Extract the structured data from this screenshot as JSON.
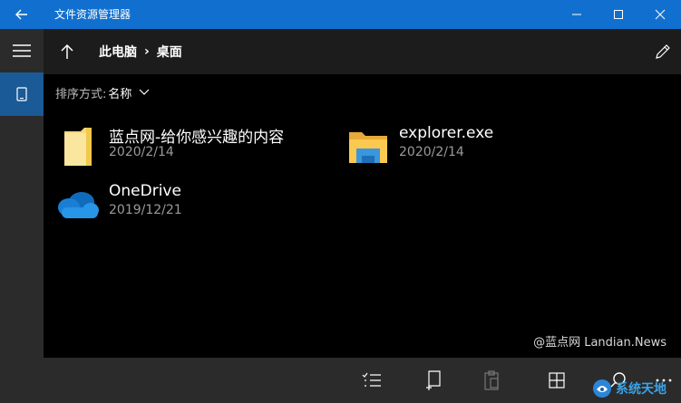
{
  "titlebar": {
    "title": "文件资源管理器"
  },
  "nav": {
    "breadcrumbs": [
      "此电脑",
      "桌面"
    ],
    "separator": "›"
  },
  "sort": {
    "label": "排序方式:",
    "value": "名称"
  },
  "items": [
    {
      "name": "蓝点网-给你感兴趣的内容",
      "date": "2020/2/14",
      "icon": "folder-icon"
    },
    {
      "name": "explorer.exe",
      "date": "2020/2/14",
      "icon": "explorer-app-icon"
    },
    {
      "name": "OneDrive",
      "date": "2019/12/21",
      "icon": "onedrive-cloud-icon"
    }
  ],
  "watermark": "@蓝点网 Landian.News",
  "logo": {
    "text": "系统天地"
  },
  "colors": {
    "titlebar": "#1170cf",
    "rail": "#2b2b2b",
    "selected": "#1a5a96",
    "background": "#000000"
  }
}
